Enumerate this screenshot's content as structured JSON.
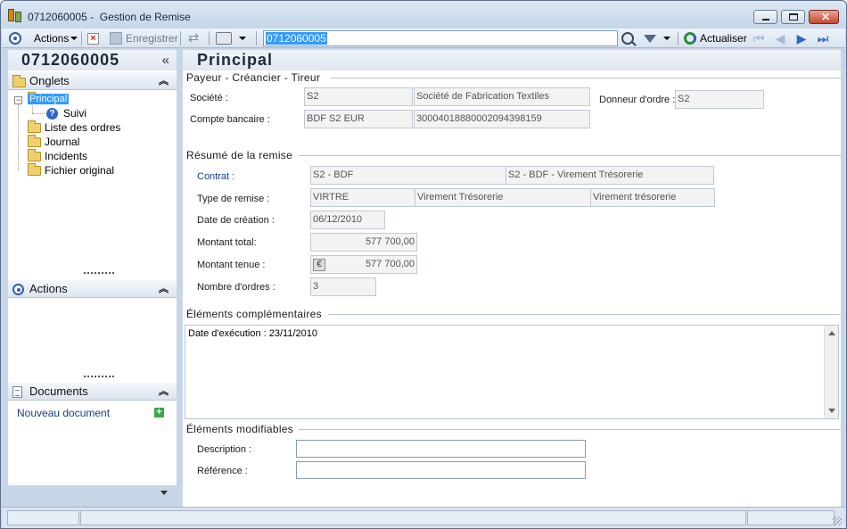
{
  "window": {
    "title": "0712060005 -  Gestion de Remise",
    "close_glyph": "✕"
  },
  "toolbar": {
    "actions_label": "Actions",
    "save_label": "Enregistrer",
    "search_value": "0712060005",
    "refresh_label": "Actualiser"
  },
  "leftpanel": {
    "header": "0712060005",
    "collapse_glyph": "«",
    "sections": {
      "onglets": "Onglets",
      "actions": "Actions",
      "documents": "Documents"
    },
    "tree": {
      "expander": "−",
      "items": [
        "Principal",
        "Suivi",
        "Liste des ordres",
        "Journal",
        "Incidents",
        "Fichier original"
      ]
    },
    "new_document": "Nouveau document"
  },
  "main": {
    "title": "Principal",
    "payeur": {
      "legend": "Payeur - Créancier - Tireur",
      "societe_label": "Société  :",
      "societe_code": "S2",
      "societe_name": "Société de Fabrication Textiles",
      "donneur_label": "Donneur d'ordre :",
      "donneur_value": "S2",
      "compte_label": "Compte bancaire :",
      "compte_code": "BDF S2 EUR",
      "compte_number": "30004018880002094398159"
    },
    "resume": {
      "legend": "Résumé de la remise",
      "contrat_label": "Contrat :",
      "contrat_code": "S2 - BDF",
      "contrat_name": "S2 - BDF - Virement Trésorerie",
      "type_label": "Type de remise :",
      "type_code": "VIRTRE",
      "type_name": "Virement Trésorerie",
      "type_name2": "Virement trésorerie",
      "date_label": "Date de création :",
      "date_value": "06/12/2010",
      "montant_label": "Montant total:",
      "montant_value": "577 700,00",
      "tenue_label": "Montant tenue :",
      "tenue_value": "577 700,00",
      "currency_glyph": "€",
      "nb_label": "Nombre d'ordres :",
      "nb_value": "3"
    },
    "complementaires": {
      "legend": "Éléments complémentaires",
      "text": "Date d'exécution : 23/11/2010"
    },
    "modifiables": {
      "legend": "Éléments modifiables",
      "description_label": "Description :",
      "description_value": "",
      "reference_label": "Référence :",
      "reference_value": ""
    }
  },
  "colors": {
    "accent": "#3399ff",
    "link": "#1a3a8c",
    "frame": "#c7d6e6"
  }
}
